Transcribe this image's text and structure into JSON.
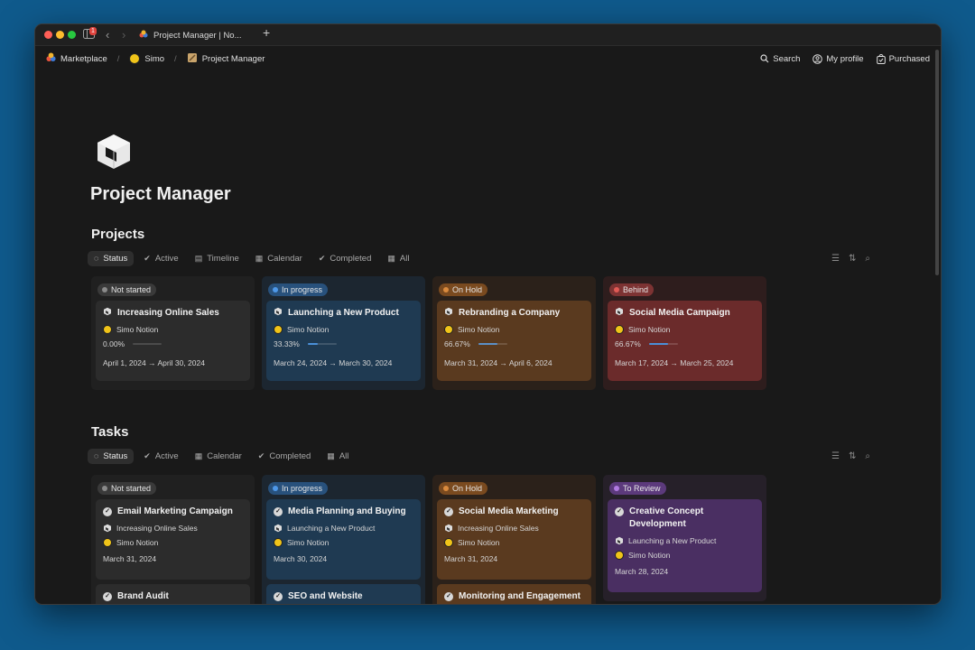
{
  "browser": {
    "tab_title": "Project Manager | No...",
    "sidebar_badge": "1",
    "new_tab": "+"
  },
  "breadcrumb": {
    "items": [
      "Marketplace",
      "Simo",
      "Project Manager"
    ]
  },
  "header_actions": {
    "search": "Search",
    "profile": "My profile",
    "purchased": "Purchased"
  },
  "page": {
    "title": "Project Manager"
  },
  "projects": {
    "title": "Projects",
    "views": [
      "Status",
      "Active",
      "Timeline",
      "Calendar",
      "Completed",
      "All"
    ],
    "columns": [
      {
        "label": "Not started",
        "cards": [
          {
            "title": "Increasing Online Sales",
            "owner": "Simo Notion",
            "progress_label": "0.00%",
            "progress": 0,
            "dates": "April 1, 2024 → April 30, 2024"
          }
        ]
      },
      {
        "label": "In progress",
        "cards": [
          {
            "title": "Launching a New Product",
            "owner": "Simo Notion",
            "progress_label": "33.33%",
            "progress": 0.3333,
            "dates": "March 24, 2024 → March 30, 2024"
          }
        ]
      },
      {
        "label": "On Hold",
        "cards": [
          {
            "title": "Rebranding a Company",
            "owner": "Simo Notion",
            "progress_label": "66.67%",
            "progress": 0.6667,
            "dates": "March 31, 2024 → April 6, 2024"
          }
        ]
      },
      {
        "label": "Behind",
        "cards": [
          {
            "title": "Social Media Campaign",
            "owner": "Simo Notion",
            "progress_label": "66.67%",
            "progress": 0.6667,
            "dates": "March 17, 2024 → March 25, 2024"
          }
        ]
      }
    ]
  },
  "tasks": {
    "title": "Tasks",
    "views": [
      "Status",
      "Active",
      "Calendar",
      "Completed",
      "All"
    ],
    "columns": [
      {
        "label": "Not started",
        "cards": [
          {
            "title": "Email Marketing Campaign",
            "project": "Increasing Online Sales",
            "owner": "Simo Notion",
            "date": "March 31, 2024"
          },
          {
            "title": "Brand Audit"
          }
        ]
      },
      {
        "label": "In progress",
        "cards": [
          {
            "title": "Media Planning and Buying",
            "project": "Launching a New Product",
            "owner": "Simo Notion",
            "date": "March 30, 2024"
          },
          {
            "title": "SEO and Website Optimization"
          }
        ]
      },
      {
        "label": "On Hold",
        "cards": [
          {
            "title": "Social Media Marketing",
            "project": "Increasing Online Sales",
            "owner": "Simo Notion",
            "date": "March 31, 2024"
          },
          {
            "title": "Monitoring and Engagement"
          }
        ]
      },
      {
        "label": "To Review",
        "cards": [
          {
            "title": "Creative Concept Development",
            "project": "Launching a New Product",
            "owner": "Simo Notion",
            "date": "March 28, 2024"
          }
        ]
      }
    ]
  },
  "colors": {
    "desktop": "#0f5a8c",
    "window": "#191919",
    "not_started": "#5a5a5a",
    "in_progress": "#2f6db3",
    "on_hold": "#a9662a",
    "behind": "#b8433f",
    "to_review": "#7b4fb0"
  }
}
